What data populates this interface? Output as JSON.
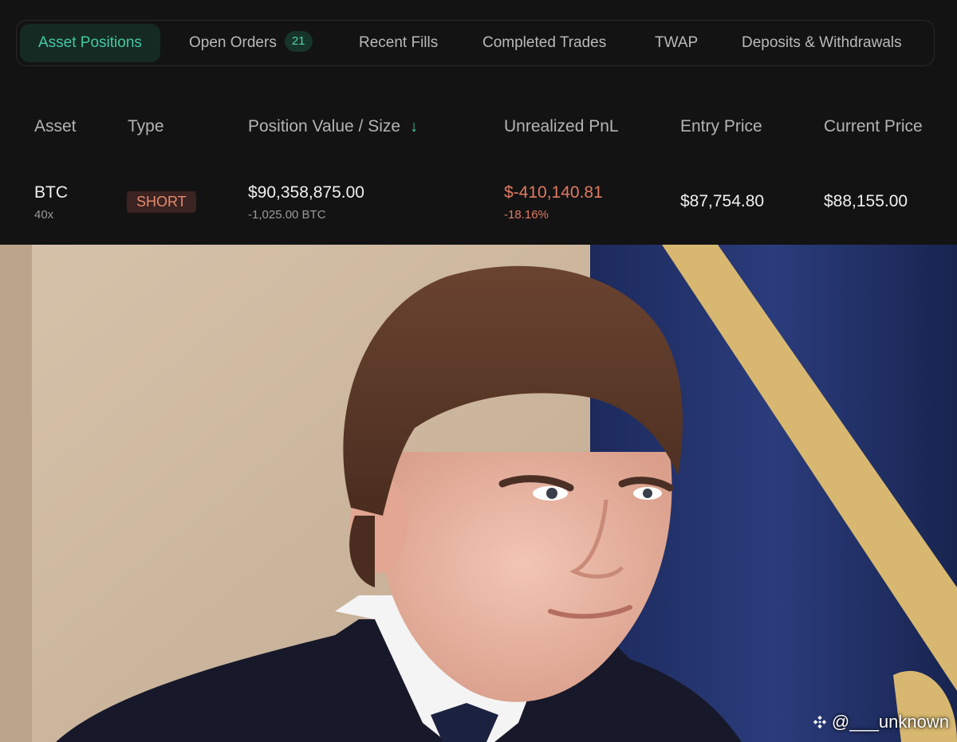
{
  "tabs": [
    {
      "label": "Asset Positions",
      "active": true
    },
    {
      "label": "Open Orders",
      "badge": "21"
    },
    {
      "label": "Recent Fills"
    },
    {
      "label": "Completed Trades"
    },
    {
      "label": "TWAP"
    },
    {
      "label": "Deposits & Withdrawals"
    }
  ],
  "table": {
    "columns": [
      "Asset",
      "Type",
      "Position Value / Size",
      "Unrealized PnL",
      "Entry Price",
      "Current Price"
    ],
    "sort_icon": "arrow-down-icon",
    "row": {
      "asset": "BTC",
      "leverage": "40x",
      "type": "SHORT",
      "position_value": "$90,358,875.00",
      "size": "-1,025.00 BTC",
      "pnl": "$-410,140.81",
      "pnl_pct": "-18.16%",
      "entry_price": "$87,754.80",
      "current_price": "$88,155.00"
    }
  },
  "credit": {
    "handle": "@___unknown",
    "icon": "binance-logo-icon"
  },
  "colors": {
    "accent": "#43c9a0",
    "negative": "#e07a62",
    "background": "#131313"
  }
}
